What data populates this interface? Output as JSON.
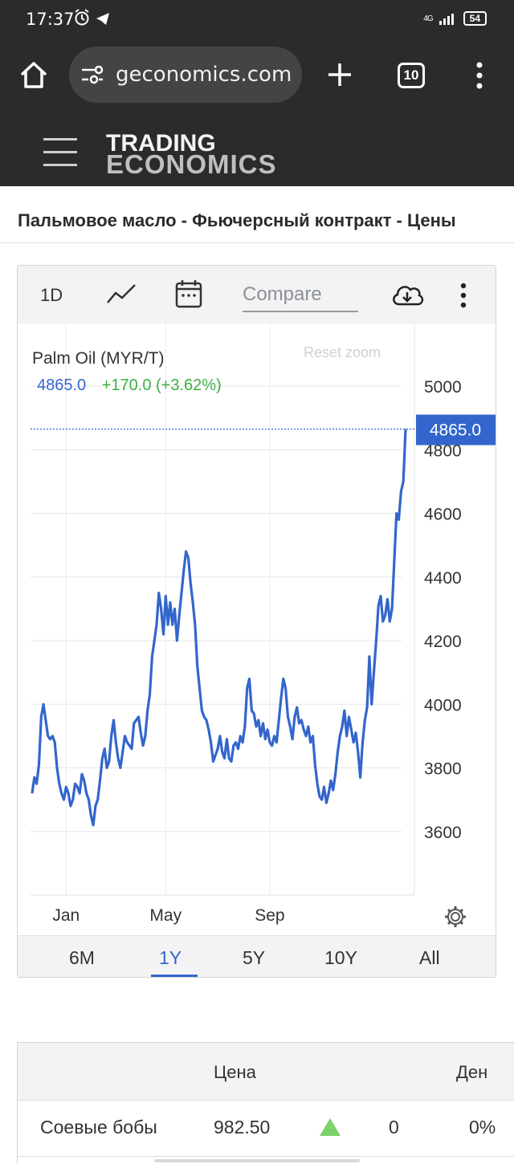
{
  "status": {
    "time": "17:37",
    "network": "4G",
    "battery": "54"
  },
  "browser": {
    "url": "geconomics.com",
    "tab_count": "10"
  },
  "site": {
    "logo_line1": "TRADING",
    "logo_line2": "ECONOMICS"
  },
  "page": {
    "title": "Пальмовое масло - Фьючерсный контракт - Цены"
  },
  "chart_toolbar": {
    "interval": "1D",
    "compare_placeholder": "Compare"
  },
  "chart_legend": {
    "title": "Palm Oil (MYR/T)",
    "value": "4865.0",
    "change": "+170.0 (+3.62%)",
    "reset_zoom": "Reset zoom"
  },
  "chart_data": {
    "type": "line",
    "series": [
      {
        "name": "Palm Oil (MYR/T)",
        "color": "#3366cc",
        "values": [
          3720,
          3770,
          3750,
          3810,
          3960,
          4000,
          3950,
          3900,
          3890,
          3900,
          3880,
          3800,
          3750,
          3720,
          3700,
          3740,
          3720,
          3680,
          3700,
          3750,
          3740,
          3720,
          3780,
          3760,
          3720,
          3700,
          3650,
          3620,
          3680,
          3700,
          3760,
          3830,
          3860,
          3800,
          3820,
          3900,
          3950,
          3880,
          3830,
          3800,
          3850,
          3900,
          3880,
          3870,
          3860,
          3940,
          3950,
          3960,
          3910,
          3870,
          3900,
          3980,
          4030,
          4150,
          4200,
          4250,
          4350,
          4300,
          4220,
          4340,
          4250,
          4320,
          4250,
          4300,
          4200,
          4280,
          4350,
          4420,
          4480,
          4460,
          4380,
          4320,
          4250,
          4120,
          4050,
          3980,
          3960,
          3950,
          3920,
          3880,
          3820,
          3840,
          3860,
          3900,
          3850,
          3830,
          3890,
          3830,
          3820,
          3870,
          3880,
          3860,
          3900,
          3880,
          3930,
          4050,
          4080,
          3980,
          3970,
          3930,
          3950,
          3900,
          3940,
          3890,
          3920,
          3880,
          3870,
          3900,
          3880,
          3950,
          4020,
          4080,
          4050,
          3960,
          3930,
          3890,
          3960,
          3990,
          3940,
          3950,
          3920,
          3900,
          3930,
          3880,
          3900,
          3810,
          3750,
          3710,
          3700,
          3740,
          3690,
          3720,
          3760,
          3730,
          3780,
          3850,
          3900,
          3930,
          3980,
          3900,
          3960,
          3920,
          3880,
          3910,
          3850,
          3770,
          3880,
          3950,
          3990,
          4150,
          4000,
          4100,
          4200,
          4310,
          4340,
          4260,
          4280,
          4330,
          4260,
          4300,
          4450,
          4600,
          4580,
          4670,
          4700,
          4865
        ]
      }
    ],
    "x_tick_labels": [
      "Jan",
      "May",
      "Sep"
    ],
    "x_tick_index": [
      15,
      59,
      105
    ],
    "y_ticks": [
      3600,
      3800,
      4000,
      4200,
      4400,
      4600,
      4800,
      5000
    ],
    "ylim": [
      3400,
      5000
    ],
    "current_value": 4865.0,
    "grid": true
  },
  "range_buttons": [
    "6M",
    "1Y",
    "5Y",
    "10Y",
    "All"
  ],
  "range_active": "1Y",
  "table": {
    "headers": [
      "Цена",
      "Ден"
    ],
    "rows": [
      {
        "name": "Соевые бобы",
        "price": "982.50",
        "change": "0",
        "pct": "0%"
      }
    ]
  }
}
